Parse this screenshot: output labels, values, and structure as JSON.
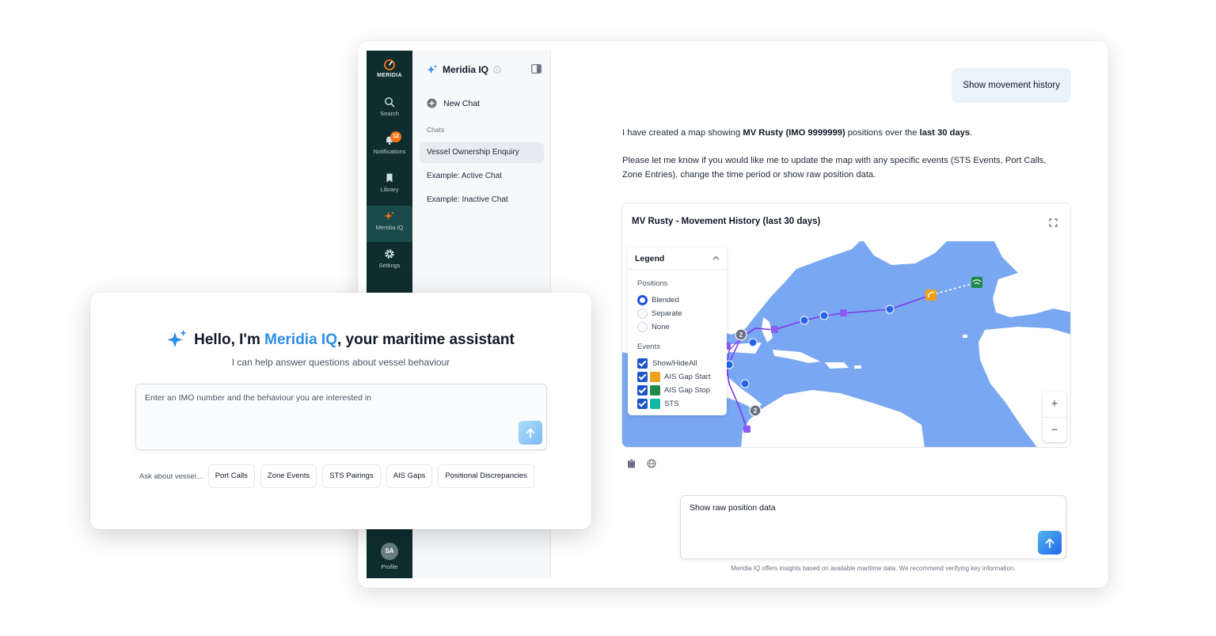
{
  "rail": {
    "logo_text": "MERIDIA",
    "items": [
      {
        "label": "Search",
        "icon": "search-icon"
      },
      {
        "label": "Notifications",
        "icon": "bell-icon",
        "badge": "12"
      },
      {
        "label": "Library",
        "icon": "bookmark-icon"
      },
      {
        "label": "Meridia IQ",
        "icon": "sparkle-icon"
      },
      {
        "label": "Settings",
        "icon": "gear-icon"
      }
    ],
    "profile": {
      "initials": "SA",
      "label": "Profile"
    }
  },
  "sidebar": {
    "title": "Meridia IQ",
    "new_chat": "New Chat",
    "section": "Chats",
    "chats": [
      "Vessel Ownership Enquiry",
      "Example: Active Chat",
      "Example: Inactive Chat"
    ]
  },
  "conversation": {
    "user_message": "Show movement history",
    "reply_p1": {
      "pre": "I have created a map showing ",
      "vessel": "MV Rusty (IMO 9999999)",
      "mid": " positions over the ",
      "period": "last 30 days",
      "post": "."
    },
    "reply_p2": "Please let me know if you would like me to update the map with any specific events (STS Events, Port Calls, Zone Entries), change the time period or show raw position data."
  },
  "map": {
    "title": "MV Rusty - Movement History (last 30 days)",
    "legend": {
      "title": "Legend",
      "positions_label": "Positions",
      "positions": [
        {
          "label": "Blended",
          "selected": true
        },
        {
          "label": "Separate",
          "selected": false
        },
        {
          "label": "None",
          "selected": false
        }
      ],
      "events_label": "Events",
      "events": [
        {
          "label": "Show/HideAll",
          "icon": ""
        },
        {
          "label": "AIS Gap Start",
          "icon": "ais-gap-start-icon",
          "color": "#f0a020"
        },
        {
          "label": "AIS Gap Stop",
          "icon": "ais-gap-stop-icon",
          "color": "#1f8a4c"
        },
        {
          "label": "STS",
          "icon": "sts-icon",
          "color": "#14b8a6"
        }
      ]
    },
    "zoom_in": "+",
    "zoom_out": "−",
    "cluster_labels": [
      "2",
      "2"
    ]
  },
  "composer": {
    "value": "Show raw position data",
    "disclaimer": "Meridia IQ offers insights based on available maritime data. We recommend verifying key information."
  },
  "overlay": {
    "greeting_pre": "Hello, I'm ",
    "greeting_brand": "Meridia IQ",
    "greeting_post": ", your maritime assistant",
    "subtitle": "I can help answer questions about vessel behaviour",
    "input_placeholder": "Enter an IMO number and the behaviour you are interested in",
    "chips_lead": "Ask about vessel...",
    "chips": [
      "Port Calls",
      "Zone Events",
      "STS Pairings",
      "AIS Gaps",
      "Positional Discrepancies"
    ]
  },
  "colors": {
    "rail": "#0f2d2f",
    "brand_blue": "#2d8fe6",
    "ocean": "#79a7f1",
    "track": "#7c3aed"
  }
}
